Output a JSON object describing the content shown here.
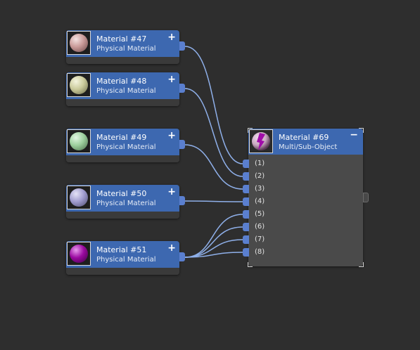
{
  "materials": [
    {
      "title": "Material #47",
      "subtitle": "Physical Material",
      "color": "#c99a98"
    },
    {
      "title": "Material #48",
      "subtitle": "Physical Material",
      "color": "#cbcb9c"
    },
    {
      "title": "Material #49",
      "subtitle": "Physical Material",
      "color": "#9dcf9d"
    },
    {
      "title": "Material #50",
      "subtitle": "Physical Material",
      "color": "#a19dcf"
    },
    {
      "title": "Material #51",
      "subtitle": "Physical Material",
      "color": "#9a0aa0"
    }
  ],
  "add_symbol": "+",
  "multi": {
    "title": "Material #69",
    "subtitle": "Multi/Sub-Object",
    "collapse_symbol": "−",
    "slots": [
      "(1)",
      "(2)",
      "(3)",
      "(4)",
      "(5)",
      "(6)",
      "(7)",
      "(8)"
    ]
  },
  "colors": {
    "background": "#2e2e2e",
    "node_header": "#3d68b0",
    "port": "#5a7fcf",
    "wire": "#8fb0ea"
  }
}
